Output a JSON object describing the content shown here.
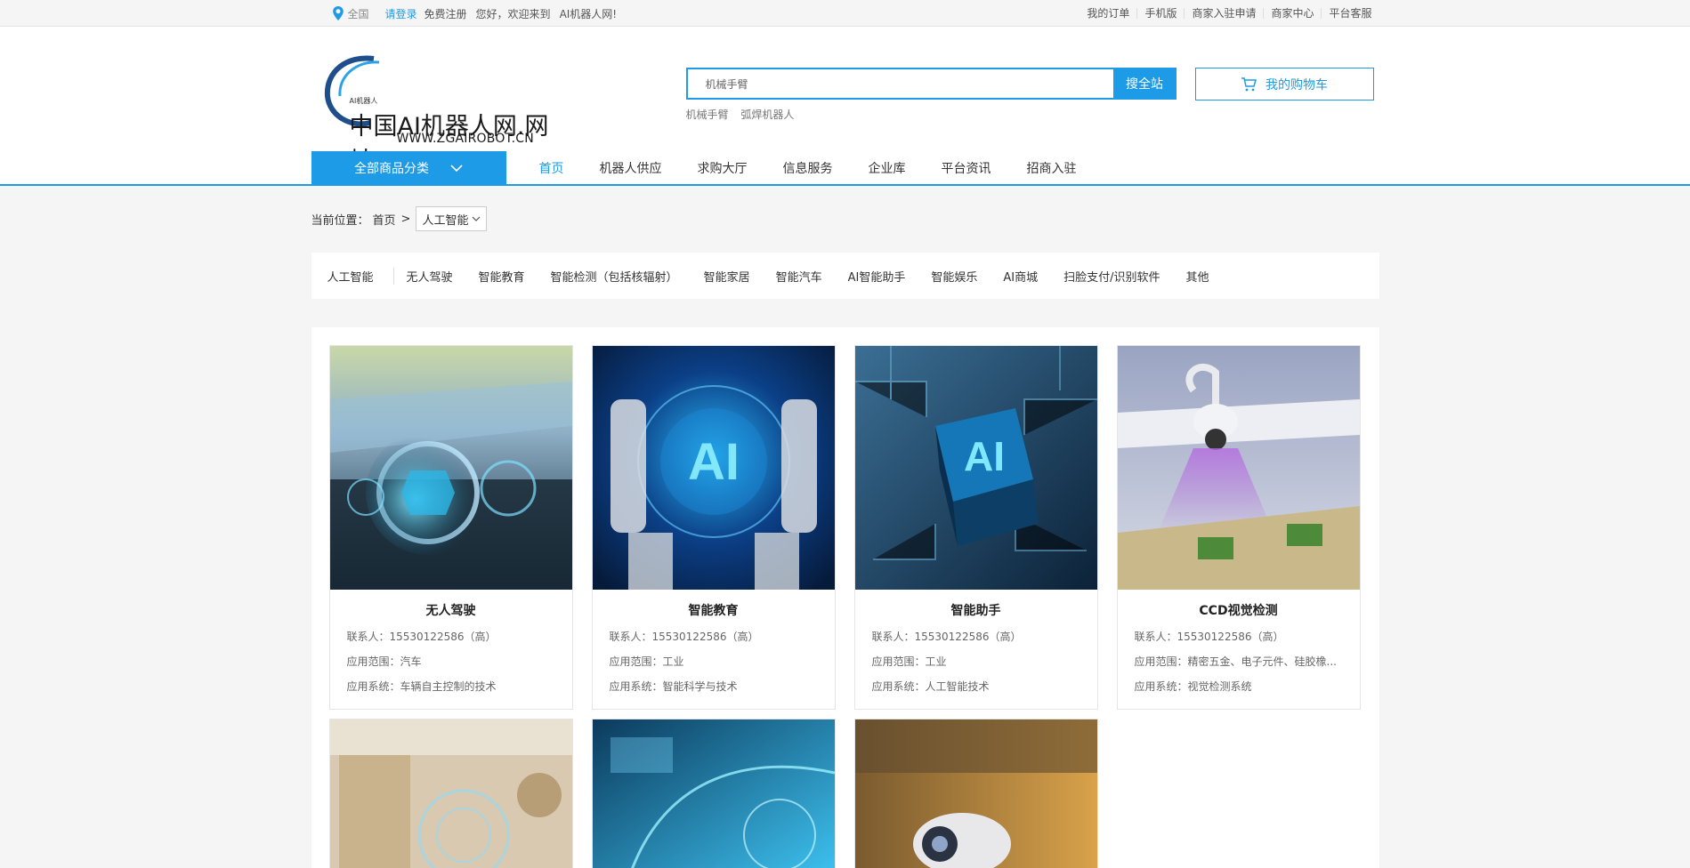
{
  "topbar": {
    "region": "全国",
    "login": "请登录",
    "register": "免费注册",
    "welcome": "您好，欢迎来到",
    "site_name": "AI机器人网!",
    "links": [
      "我的订单",
      "手机版",
      "商家入驻申请",
      "商家中心",
      "平台客服"
    ]
  },
  "header": {
    "logo_small": "AI机器人",
    "logo_cn": "中国AI机器人网.网址",
    "logo_en": "WWW.ZGAIROBOT.CN",
    "search_placeholder": "机械手臂",
    "search_button": "搜全站",
    "hot_words": [
      "机械手臂",
      "弧焊机器人"
    ],
    "cart_label": "我的购物车"
  },
  "nav": {
    "category_button": "全部商品分类",
    "items": [
      "首页",
      "机器人供应",
      "求购大厅",
      "信息服务",
      "企业库",
      "平台资讯",
      "招商入驻"
    ]
  },
  "breadcrumb": {
    "label": "当前位置：",
    "home": "首页",
    "sep": ">",
    "current": "人工智能"
  },
  "categories": [
    "人工智能",
    "无人驾驶",
    "智能教育",
    "智能检测（包括核辐射）",
    "智能家居",
    "智能汽车",
    "AI智能助手",
    "智能娱乐",
    "AI商城",
    "扫脸支付/识别软件",
    "其他"
  ],
  "products": [
    {
      "title": "无人驾驶",
      "contact": "联系人：15530122586（高）",
      "scope": "应用范围：汽车",
      "system": "应用系统：车辆自主控制的技术"
    },
    {
      "title": "智能教育",
      "contact": "联系人：15530122586（高）",
      "scope": "应用范围：工业",
      "system": "应用系统：智能科学与技术"
    },
    {
      "title": "智能助手",
      "contact": "联系人：15530122586（高）",
      "scope": "应用范围：工业",
      "system": "应用系统：人工智能技术"
    },
    {
      "title": "CCD视觉检测",
      "contact": "联系人：15530122586（高）",
      "scope": "应用范围：精密五金、电子元件、硅胶橡...",
      "system": "应用系统：视觉检测系统"
    }
  ],
  "colors": {
    "accent": "#1e9be6"
  }
}
